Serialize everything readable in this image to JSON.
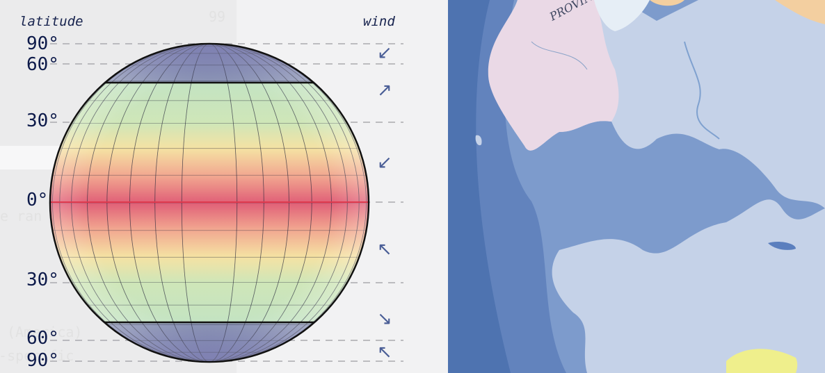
{
  "panel": {
    "latitude_header": "latitude",
    "wind_header": "wind",
    "latitude_labels": [
      "90°",
      "60°",
      "30°",
      "0°",
      "30°",
      "60°",
      "90°"
    ],
    "wind_arrows": [
      "↙",
      "↗",
      "↙",
      "↖",
      "↘",
      "↖"
    ],
    "background_text": [
      "99",
      "te ran",
      "n (America)",
      "e-specific"
    ],
    "colors": {
      "polar": "#5b5c97",
      "temperate": "#c9e4c0",
      "subtropical": "#f7e3a3",
      "tropical": "#e36d7c",
      "equator_line": "#e03a4e",
      "text": "#0d1a4a"
    }
  },
  "map": {
    "label": "PROVINCE OF BOS",
    "colors": {
      "deep_water": "#4e73b0",
      "shelf_water": "#7d9bcc",
      "land": "#c5d2e8",
      "province_pink": "#ead9e6",
      "province_yellow": "#efef8c",
      "province_orange": "#f3cfa0"
    }
  }
}
